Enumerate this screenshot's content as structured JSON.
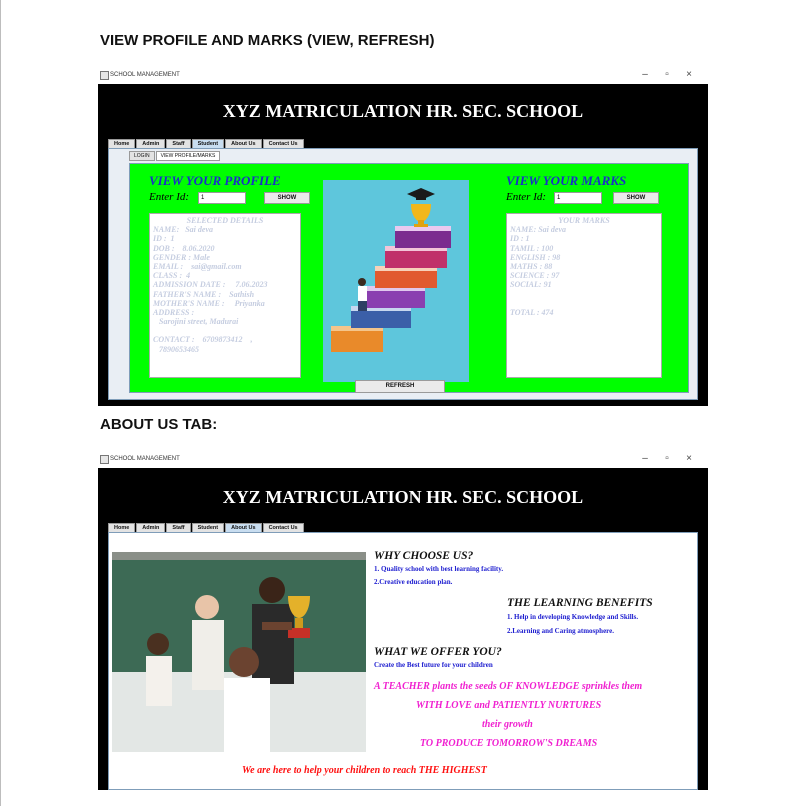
{
  "headings": {
    "profile": "VIEW PROFILE AND MARKS (VIEW, REFRESH)",
    "about": "ABOUT US TAB:"
  },
  "window": {
    "title": "SCHOOL MANAGEMENT",
    "minimize": "–",
    "maximize": "▫",
    "close": "×",
    "banner": "XYZ MATRICULATION HR. SEC. SCHOOL"
  },
  "tabs": [
    "Home",
    "Admin",
    "Staff",
    "Student",
    "About Us",
    "Contact Us"
  ],
  "student": {
    "subtabs": [
      "LOGIN",
      "VIEW PROFILE/MARKS"
    ],
    "profile": {
      "title": "VIEW YOUR PROFILE",
      "id_label": "Enter Id:",
      "id_value": "1",
      "show": "SHOW",
      "box_heading": "SELECTED DETAILS",
      "lines": [
        "NAME:   Sai deva",
        "ID :  1",
        "DOB :    8.06.2020",
        "GENDER : Male",
        "EMAIL :    sai@gmail.com",
        "CLASS :  4",
        "ADMISSION DATE :     7.06.2023",
        "FATHER'S NAME :    Sathish",
        "MOTHER'S NAME :     Priyanka",
        "ADDRESS :",
        "   Sarojini street, Madurai",
        "",
        "CONTACT :    6709873412    ,",
        "   7890653465"
      ]
    },
    "marks": {
      "title": "VIEW YOUR MARKS",
      "id_label": "Enter Id:",
      "id_value": "1",
      "show": "SHOW",
      "box_heading": "YOUR MARKS",
      "lines": [
        "NAME: Sai deva",
        "ID : 1",
        "TAMIL : 100",
        "ENGLISH : 98",
        "MATHS : 88",
        "SCIENCE : 97",
        "SOCIAL: 91",
        "",
        "",
        "TOTAL : 474"
      ]
    },
    "refresh": "REFRESH"
  },
  "about": {
    "why_title": "WHY CHOOSE US?",
    "why_1": "1. Quality school with best learning facility.",
    "why_2": "2.Creative education plan.",
    "benefits_title": "THE LEARNING BENEFITS",
    "benefit_1": "1. Help in developing Knowledge and Skills.",
    "benefit_2": "2.Learning and Caring atmosphere.",
    "offer_title": "WHAT WE OFFER YOU?",
    "offer_1": "Create the Best future for your children",
    "quote_1": "A TEACHER plants the seeds OF KNOWLEDGE sprinkles them",
    "quote_2": "WITH LOVE and PATIENTLY NURTURES",
    "quote_3": "their growth",
    "quote_4": "TO PRODUCE TOMORROW'S DREAMS",
    "tagline": "We are here to help your children to reach THE HIGHEST"
  }
}
